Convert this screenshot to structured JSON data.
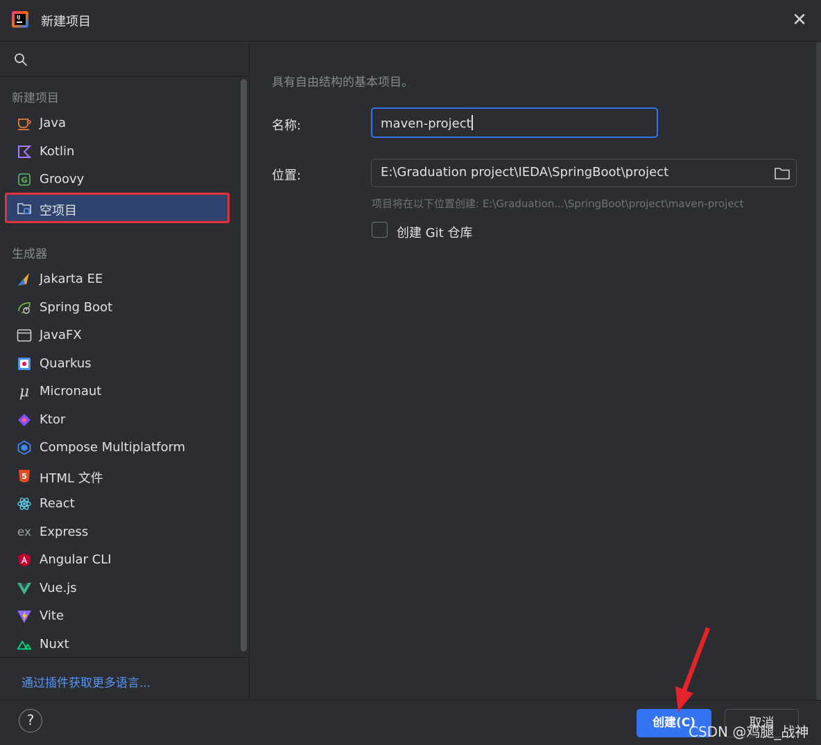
{
  "window": {
    "title": "新建项目"
  },
  "sidebar": {
    "section_new": "新建项目",
    "new_items": [
      {
        "label": "Java",
        "icon": "java-icon"
      },
      {
        "label": "Kotlin",
        "icon": "kotlin-icon"
      },
      {
        "label": "Groovy",
        "icon": "groovy-icon"
      },
      {
        "label": "空项目",
        "icon": "empty-project-icon",
        "selected": true
      }
    ],
    "section_generators": "生成器",
    "generator_items": [
      {
        "label": "Jakarta EE",
        "icon": "jakarta-ee-icon"
      },
      {
        "label": "Spring Boot",
        "icon": "spring-boot-icon"
      },
      {
        "label": "JavaFX",
        "icon": "javafx-icon"
      },
      {
        "label": "Quarkus",
        "icon": "quarkus-icon"
      },
      {
        "label": "Micronaut",
        "icon": "micronaut-icon"
      },
      {
        "label": "Ktor",
        "icon": "ktor-icon"
      },
      {
        "label": "Compose Multiplatform",
        "icon": "compose-icon"
      },
      {
        "label": "HTML 文件",
        "icon": "html5-icon"
      },
      {
        "label": "React",
        "icon": "react-icon"
      },
      {
        "label": "Express",
        "icon": "express-icon"
      },
      {
        "label": "Angular CLI",
        "icon": "angular-icon"
      },
      {
        "label": "Vue.js",
        "icon": "vue-icon"
      },
      {
        "label": "Vite",
        "icon": "vite-icon"
      },
      {
        "label": "Nuxt",
        "icon": "nuxt-icon"
      }
    ],
    "plugin_link": "通过插件获取更多语言..."
  },
  "form": {
    "description": "具有自由结构的基本项目。",
    "name_label": "名称:",
    "name_value": "maven-project",
    "location_label": "位置:",
    "location_value": "E:\\Graduation project\\IEDA\\SpringBoot\\project",
    "location_hint": "项目将在以下位置创建: E:\\Graduation...\\SpringBoot\\project\\maven-project",
    "git_checkbox_label": "创建 Git 仓库",
    "git_checked": false
  },
  "footer": {
    "help_label": "?",
    "create_label": "创建(C)",
    "cancel_label": "取消"
  },
  "colors": {
    "accent": "#3574f0",
    "selection_bg": "#2e436e",
    "highlight_border": "#e5323a",
    "link": "#5895f3"
  },
  "watermark": "CSDN @鸡腿_战神"
}
